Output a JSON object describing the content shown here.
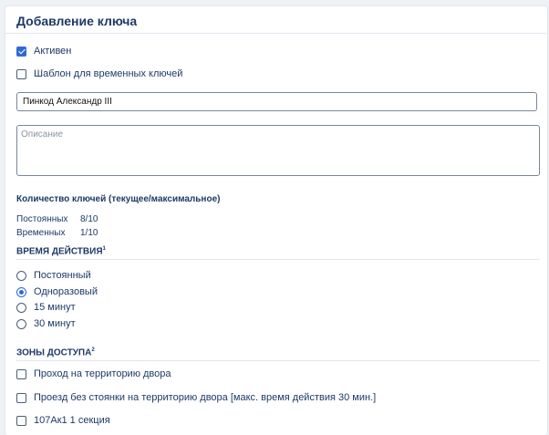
{
  "dialog": {
    "title": "Добавление ключа"
  },
  "options": {
    "active": {
      "label": "Активен",
      "checked": true
    },
    "template": {
      "label": "Шаблон для временных ключей",
      "checked": false
    }
  },
  "name_field": {
    "value": "Пинкод Александр III"
  },
  "description_field": {
    "placeholder": "Описание",
    "value": ""
  },
  "keys_count": {
    "heading": "Количество ключей (текущее/максимальное)",
    "rows": [
      {
        "label": "Постоянных",
        "value": "8/10"
      },
      {
        "label": "Временных",
        "value": "1/10"
      }
    ]
  },
  "validity": {
    "heading": "ВРЕМЯ ДЕЙСТВИЯ",
    "footnote": "1",
    "options": [
      {
        "label": "Постоянный",
        "selected": false
      },
      {
        "label": "Одноразовый",
        "selected": true
      },
      {
        "label": "15 минут",
        "selected": false
      },
      {
        "label": "30 минут",
        "selected": false
      }
    ]
  },
  "zones": {
    "heading": "ЗОНЫ ДОСТУПА",
    "footnote": "2",
    "items": [
      {
        "label": "Проход на территорию двора",
        "checked": false
      },
      {
        "label": "Проезд без стоянки на территорию двора [макс. время действия 30 мин.]",
        "checked": false
      },
      {
        "label": "107Ак1 1 секция",
        "checked": false
      }
    ]
  },
  "colors": {
    "accent": "#2e6bd6",
    "text": "#1d3a66",
    "background": "#eef1f5"
  }
}
